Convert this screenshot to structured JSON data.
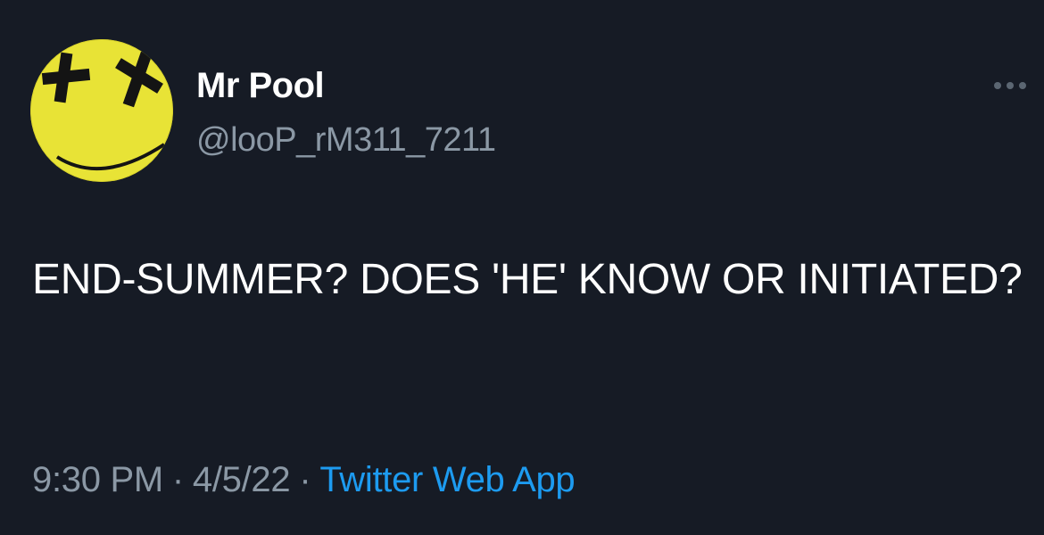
{
  "tweet": {
    "display_name": "Mr Pool",
    "handle": "@looP_rM311_7211",
    "text": "END-SUMMER? DOES 'HE' KNOW OR INITIATED?",
    "time": "9:30 PM",
    "separator": "·",
    "date": "4/5/22",
    "source": "Twitter Web App"
  },
  "icons": {
    "more": "more-horizontal-icon",
    "avatar": "yellow-smiley-face-with-x-eyes"
  },
  "colors": {
    "background": "#161b25",
    "text": "#ffffff",
    "muted": "#8b98a5",
    "link": "#1d9bf0",
    "avatar_yellow": "#e8e336"
  }
}
